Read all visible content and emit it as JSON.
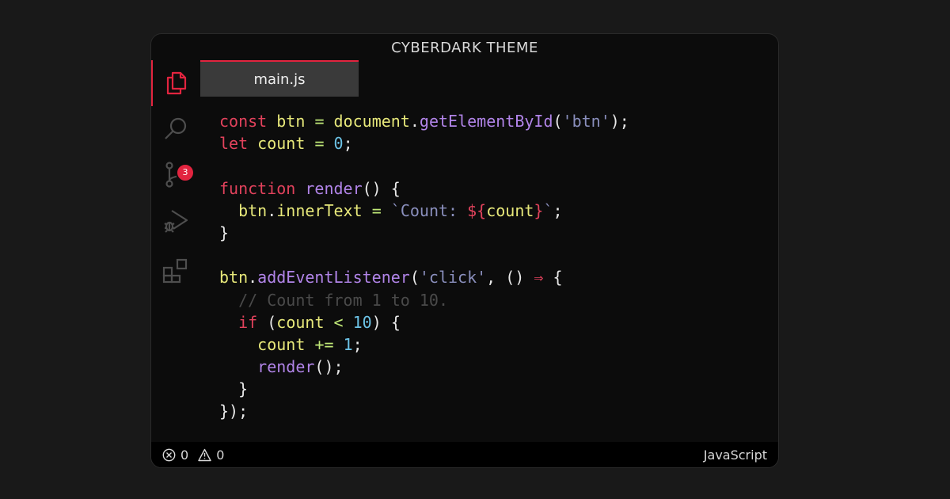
{
  "window": {
    "title": "CYBERDARK THEME"
  },
  "activity_bar": {
    "items": [
      {
        "icon": "files-icon",
        "active": true
      },
      {
        "icon": "search-icon",
        "active": false
      },
      {
        "icon": "source-control-icon",
        "badge": "3"
      },
      {
        "icon": "run-debug-icon",
        "active": false
      },
      {
        "icon": "extensions-icon",
        "active": false
      }
    ]
  },
  "tab": {
    "label": "main.js"
  },
  "code_lines": [
    [
      [
        "kw",
        "const"
      ],
      [
        "plain",
        " "
      ],
      [
        "var",
        "btn"
      ],
      [
        "plain",
        " "
      ],
      [
        "op",
        "="
      ],
      [
        "plain",
        " "
      ],
      [
        "var",
        "document"
      ],
      [
        "plain",
        "."
      ],
      [
        "fn",
        "getElementById"
      ],
      [
        "plain",
        "("
      ],
      [
        "str",
        "'btn'"
      ],
      [
        "plain",
        ");"
      ]
    ],
    [
      [
        "kw",
        "let"
      ],
      [
        "plain",
        " "
      ],
      [
        "var",
        "count"
      ],
      [
        "plain",
        " "
      ],
      [
        "op",
        "="
      ],
      [
        "plain",
        " "
      ],
      [
        "num",
        "0"
      ],
      [
        "plain",
        ";"
      ]
    ],
    [],
    [
      [
        "kw",
        "function"
      ],
      [
        "plain",
        " "
      ],
      [
        "fn",
        "render"
      ],
      [
        "plain",
        "() {"
      ]
    ],
    [
      [
        "plain",
        "  "
      ],
      [
        "var",
        "btn"
      ],
      [
        "plain",
        "."
      ],
      [
        "var",
        "innerText"
      ],
      [
        "plain",
        " "
      ],
      [
        "op",
        "="
      ],
      [
        "plain",
        " "
      ],
      [
        "str",
        "`Count: "
      ],
      [
        "tpl",
        "${"
      ],
      [
        "var",
        "count"
      ],
      [
        "tpl",
        "}"
      ],
      [
        "str",
        "`"
      ],
      [
        "plain",
        ";"
      ]
    ],
    [
      [
        "plain",
        "}"
      ]
    ],
    [],
    [
      [
        "var",
        "btn"
      ],
      [
        "plain",
        "."
      ],
      [
        "fn",
        "addEventListener"
      ],
      [
        "plain",
        "("
      ],
      [
        "str",
        "'click'"
      ],
      [
        "plain",
        ", () "
      ],
      [
        "arrow",
        "⇒"
      ],
      [
        "plain",
        " {"
      ]
    ],
    [
      [
        "plain",
        "  "
      ],
      [
        "cmt",
        "// Count from 1 to 10."
      ]
    ],
    [
      [
        "plain",
        "  "
      ],
      [
        "kw",
        "if"
      ],
      [
        "plain",
        " ("
      ],
      [
        "var",
        "count"
      ],
      [
        "plain",
        " "
      ],
      [
        "op",
        "<"
      ],
      [
        "plain",
        " "
      ],
      [
        "num",
        "10"
      ],
      [
        "plain",
        ") {"
      ]
    ],
    [
      [
        "plain",
        "    "
      ],
      [
        "var",
        "count"
      ],
      [
        "plain",
        " "
      ],
      [
        "op",
        "+="
      ],
      [
        "plain",
        " "
      ],
      [
        "num",
        "1"
      ],
      [
        "plain",
        ";"
      ]
    ],
    [
      [
        "plain",
        "    "
      ],
      [
        "fn",
        "render"
      ],
      [
        "plain",
        "();"
      ]
    ],
    [
      [
        "plain",
        "  }"
      ]
    ],
    [
      [
        "plain",
        "});"
      ]
    ]
  ],
  "status_bar": {
    "errors": "0",
    "warnings": "0",
    "language": "JavaScript"
  },
  "colors": {
    "accent": "#e2243f",
    "keyword": "#e2425c",
    "variable": "#e7e87a",
    "function": "#b184e8",
    "string": "#8a8fbd",
    "number": "#6cc3e6",
    "comment": "#4a4a4a"
  }
}
